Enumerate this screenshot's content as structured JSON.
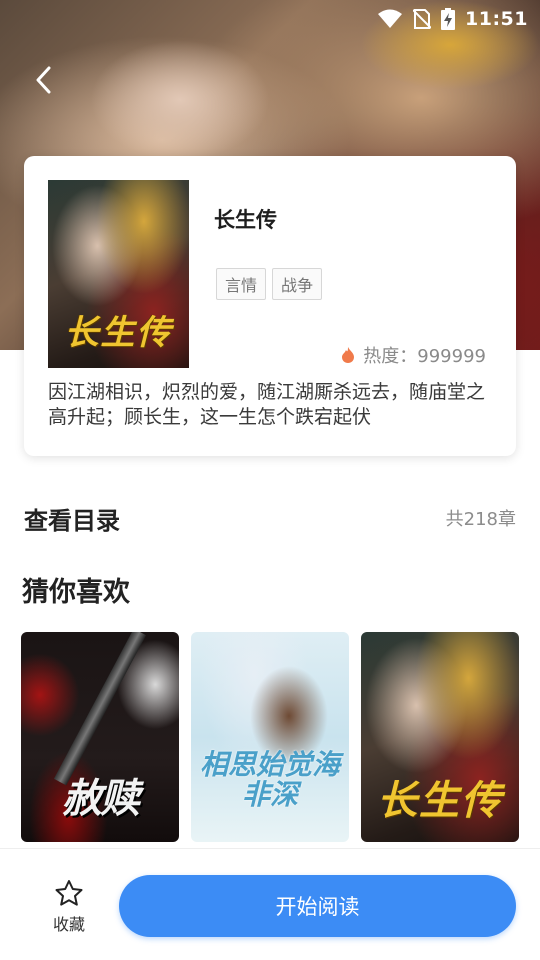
{
  "status_bar": {
    "time": "11:51"
  },
  "book": {
    "title": "长生传",
    "cover_title": "长生传",
    "tags": [
      "言情",
      "战争"
    ],
    "heat_label": "热度：999999",
    "description": "因江湖相识，炽烈的爱，随江湖厮杀远去，随庙堂之高升起；顾长生，这一生怎个跌宕起伏"
  },
  "catalog": {
    "label": "查看目录",
    "count": "共218章"
  },
  "recommend": {
    "title": "猜你喜欢",
    "books": [
      {
        "cover_title": "赦赎"
      },
      {
        "cover_title": "相思始觉海非深"
      },
      {
        "cover_title": "长生传"
      }
    ]
  },
  "bottom_bar": {
    "favorite_label": "收藏",
    "read_label": "开始阅读"
  },
  "colors": {
    "accent": "#3c8cf5",
    "cover_gold": "#f0c530"
  }
}
